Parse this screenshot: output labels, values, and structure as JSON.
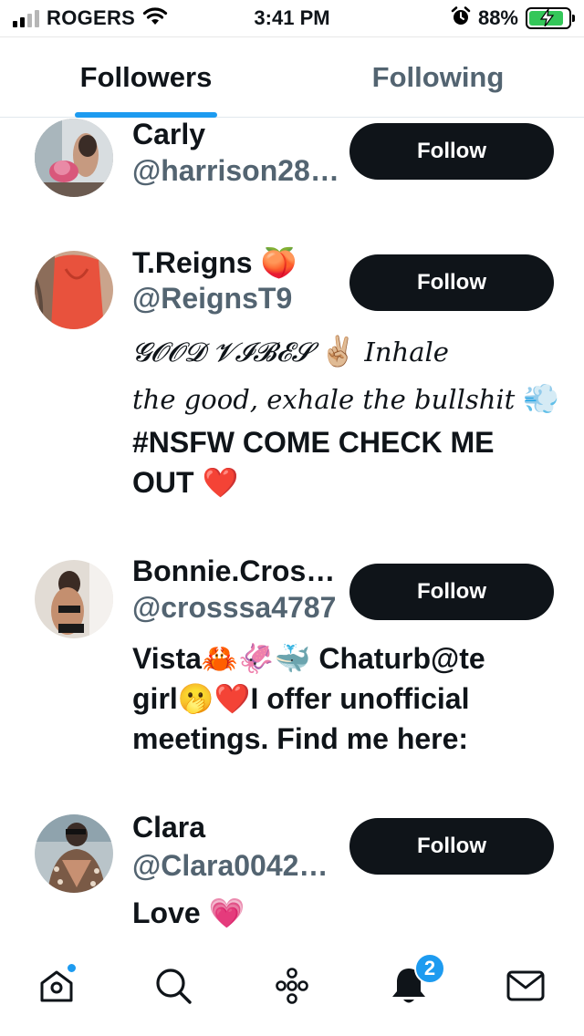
{
  "status_bar": {
    "carrier": "ROGERS",
    "time": "3:41 PM",
    "battery_percent": "88%",
    "battery_level": 0.88,
    "icons": [
      "signal-icon",
      "wifi-icon",
      "alarm-icon",
      "battery-charging-icon"
    ]
  },
  "tabs": [
    {
      "label": "Followers",
      "active": true
    },
    {
      "label": "Following",
      "active": false
    }
  ],
  "users": [
    {
      "name": "Carly",
      "name_emoji": "",
      "handle": "@harrison28…",
      "bio_lines": [],
      "button": "Follow"
    },
    {
      "name": "T.Reigns",
      "name_emoji": "🍑",
      "handle": "@ReignsT9",
      "bio_script_1": "𝓖𝓞𝓞𝓓 𝓥𝓘𝓑𝓔𝓢",
      "bio_emoji_1": "✌🏼",
      "bio_script_2": "Inhale",
      "bio_script_3": "the good, exhale the bullshit",
      "bio_emoji_2": "💨",
      "bio_line_3": "#NSFW COME CHECK ME",
      "bio_line_4": "OUT",
      "bio_emoji_3": "❤️",
      "button": "Follow"
    },
    {
      "name": "Bonnie.Cros…",
      "name_emoji": "",
      "handle": "@crosssa4787",
      "bio_line_1": "Vista🦀🦑🐳 Chaturb@te",
      "bio_line_2": "girl🫢❤️I offer unofficial",
      "bio_line_3": "meetings. Find me here:",
      "button": "Follow"
    },
    {
      "name": "Clara",
      "name_emoji": "",
      "handle": "@Clara0042…",
      "bio_line_1": "Love 💗",
      "button": "Follow"
    }
  ],
  "tab_bar": {
    "items": [
      "home-icon",
      "search-icon",
      "spaces-icon",
      "notifications-icon",
      "messages-icon"
    ],
    "notifications_badge": "2",
    "accent": "#1d9bf0"
  }
}
